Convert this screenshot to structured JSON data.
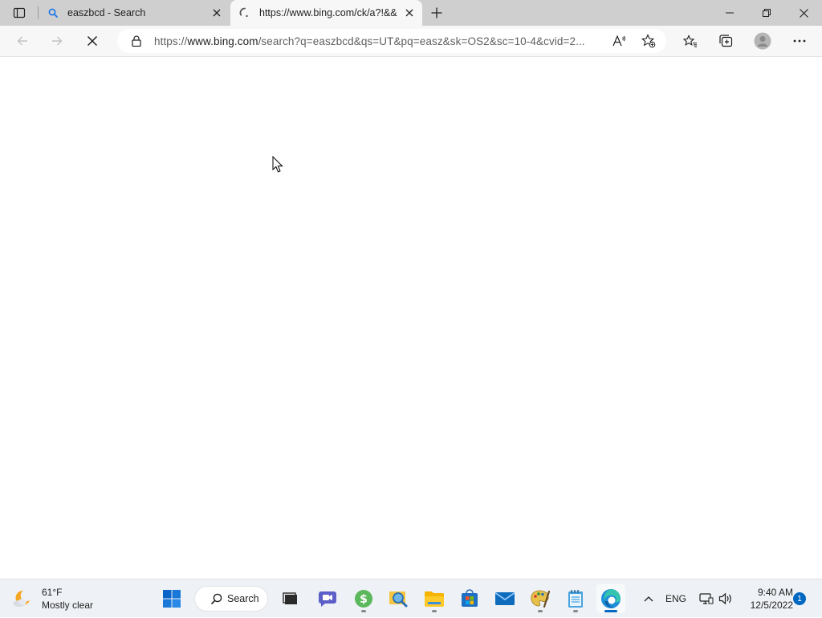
{
  "browser": {
    "tabs": [
      {
        "title": "easzbcd - Search",
        "favicon": "search-icon",
        "active": false
      },
      {
        "title": "https://www.bing.com/ck/a?!&&",
        "favicon": "loading-spinner-icon",
        "active": true
      }
    ],
    "address_bar": {
      "url_prefix": "https://",
      "url_host": "www.bing.com",
      "url_rest": "/search?q=easzbcd&qs=UT&pq=easz&sk=OS2&sc=10-4&cvid=2..."
    },
    "page_state": "loading",
    "toolbar_icons": [
      "back-icon",
      "forward-icon",
      "stop-icon",
      "lock-icon",
      "read-aloud-icon",
      "add-favorite-icon",
      "favorites-icon",
      "collections-icon",
      "profile-avatar-icon",
      "more-icon"
    ]
  },
  "taskbar": {
    "weather": {
      "temperature": "61°F",
      "condition": "Mostly clear"
    },
    "search_label": "Search",
    "apps": [
      "start-icon",
      "search-icon",
      "task-view-icon",
      "teams-chat-icon",
      "money-icon",
      "magnifier-icon",
      "file-explorer-icon",
      "store-icon",
      "mail-icon",
      "paint-icon",
      "notepad-icon",
      "edge-icon"
    ],
    "tray": {
      "language": "ENG"
    },
    "clock": {
      "time": "9:40 AM",
      "date": "12/5/2022"
    },
    "notification_count": "1"
  },
  "colors": {
    "accent": "#0067c0",
    "tabstrip": "#cfcfcf",
    "toolbar": "#f7f7f7",
    "taskbar": "#eef1f5"
  }
}
